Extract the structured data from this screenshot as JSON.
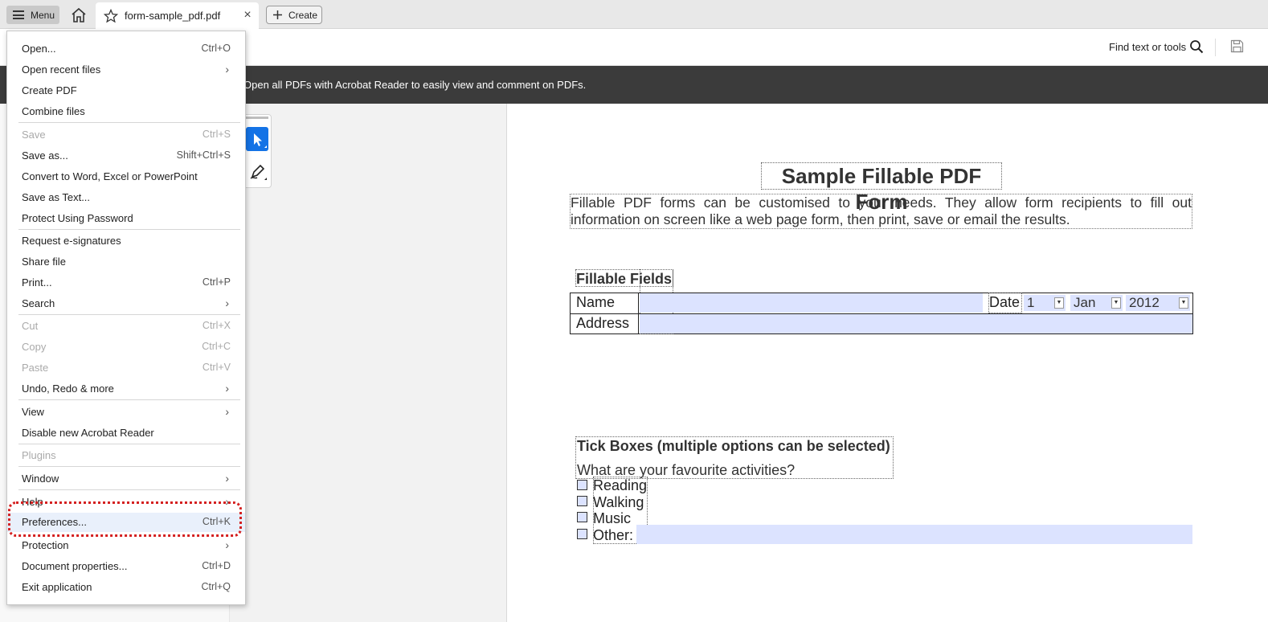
{
  "tabbar": {
    "menu_label": "Menu",
    "tab_title": "form-sample_pdf.pdf",
    "tab_close": "×",
    "create_label": "Create"
  },
  "toolbar": {
    "find_label": "Find text or tools"
  },
  "banner": {
    "text": "Open all PDFs with Acrobat Reader to easily view and comment on PDFs."
  },
  "menu": {
    "items": [
      {
        "label": "Open...",
        "shortcut": "Ctrl+O"
      },
      {
        "label": "Open recent files",
        "chevron": "›"
      },
      {
        "label": "Create PDF"
      },
      {
        "label": "Combine files"
      },
      {
        "label": "Save",
        "shortcut": "Ctrl+S",
        "disabled": true
      },
      {
        "label": "Save as...",
        "shortcut": "Shift+Ctrl+S"
      },
      {
        "label": "Convert to Word, Excel or PowerPoint"
      },
      {
        "label": "Save as Text..."
      },
      {
        "label": "Protect Using Password"
      },
      {
        "label": "Request e-signatures"
      },
      {
        "label": "Share file"
      },
      {
        "label": "Print...",
        "shortcut": "Ctrl+P"
      },
      {
        "label": "Search",
        "chevron": "›"
      },
      {
        "label": "Cut",
        "shortcut": "Ctrl+X",
        "disabled": true
      },
      {
        "label": "Copy",
        "shortcut": "Ctrl+C",
        "disabled": true
      },
      {
        "label": "Paste",
        "shortcut": "Ctrl+V",
        "disabled": true
      },
      {
        "label": "Undo, Redo & more",
        "chevron": "›"
      },
      {
        "label": "View",
        "chevron": "›"
      },
      {
        "label": "Disable new Acrobat Reader"
      },
      {
        "label": "Plugins",
        "disabled": true
      },
      {
        "label": "Window",
        "chevron": "›"
      },
      {
        "label": "Help",
        "chevron": "›"
      },
      {
        "label": "Preferences...",
        "shortcut": "Ctrl+K",
        "highlighted": true
      },
      {
        "label": "Protection",
        "chevron": "›"
      },
      {
        "label": "Document properties...",
        "shortcut": "Ctrl+D"
      },
      {
        "label": "Exit application",
        "shortcut": "Ctrl+Q"
      }
    ]
  },
  "pdf": {
    "title": "Sample Fillable PDF Form",
    "intro": "Fillable PDF forms can be customised to your needs. They allow form recipients to fill out information on screen like a web page form, then print, save or email the results.",
    "fillable_heading": "Fillable Fields",
    "name_label": "Name",
    "address_label": "Address",
    "date_label": "Date",
    "date_day": "1",
    "date_month": "Jan",
    "date_year": "2012",
    "tick_heading": "Tick Boxes (multiple options can be selected)",
    "tick_question": "What are your favourite activities?",
    "options": [
      "Reading",
      "Walking",
      "Music",
      "Other:"
    ]
  },
  "colors": {
    "accent": "#1473e6",
    "field_fill": "#dce3ff",
    "banner_bg": "#3b3b3b",
    "highlight_ring": "#d42020"
  }
}
